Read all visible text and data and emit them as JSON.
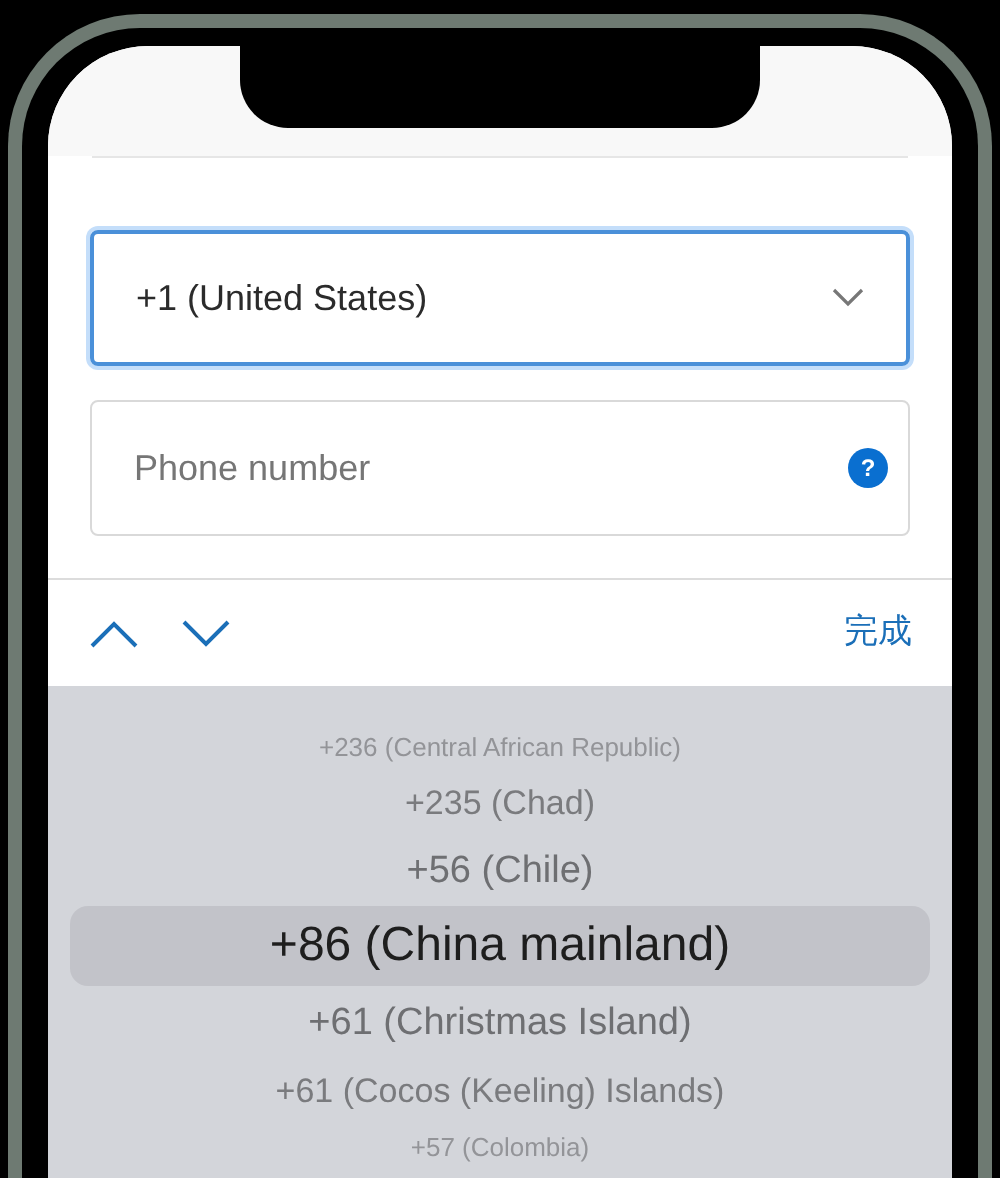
{
  "country_select": {
    "value": "+1 (United States)",
    "focused": true
  },
  "phone_field": {
    "placeholder": "Phone number",
    "help": "?"
  },
  "toolbar": {
    "done": "完成"
  },
  "picker": {
    "rows": [
      {
        "label": "+236 (Central African Republic)",
        "selected": false
      },
      {
        "label": "+235 (Chad)",
        "selected": false
      },
      {
        "label": "+56 (Chile)",
        "selected": false
      },
      {
        "label": "+86 (China mainland)",
        "selected": true
      },
      {
        "label": "+61 (Christmas Island)",
        "selected": false
      },
      {
        "label": "+61 (Cocos (Keeling) Islands)",
        "selected": false
      },
      {
        "label": "+57 (Colombia)",
        "selected": false
      }
    ]
  }
}
